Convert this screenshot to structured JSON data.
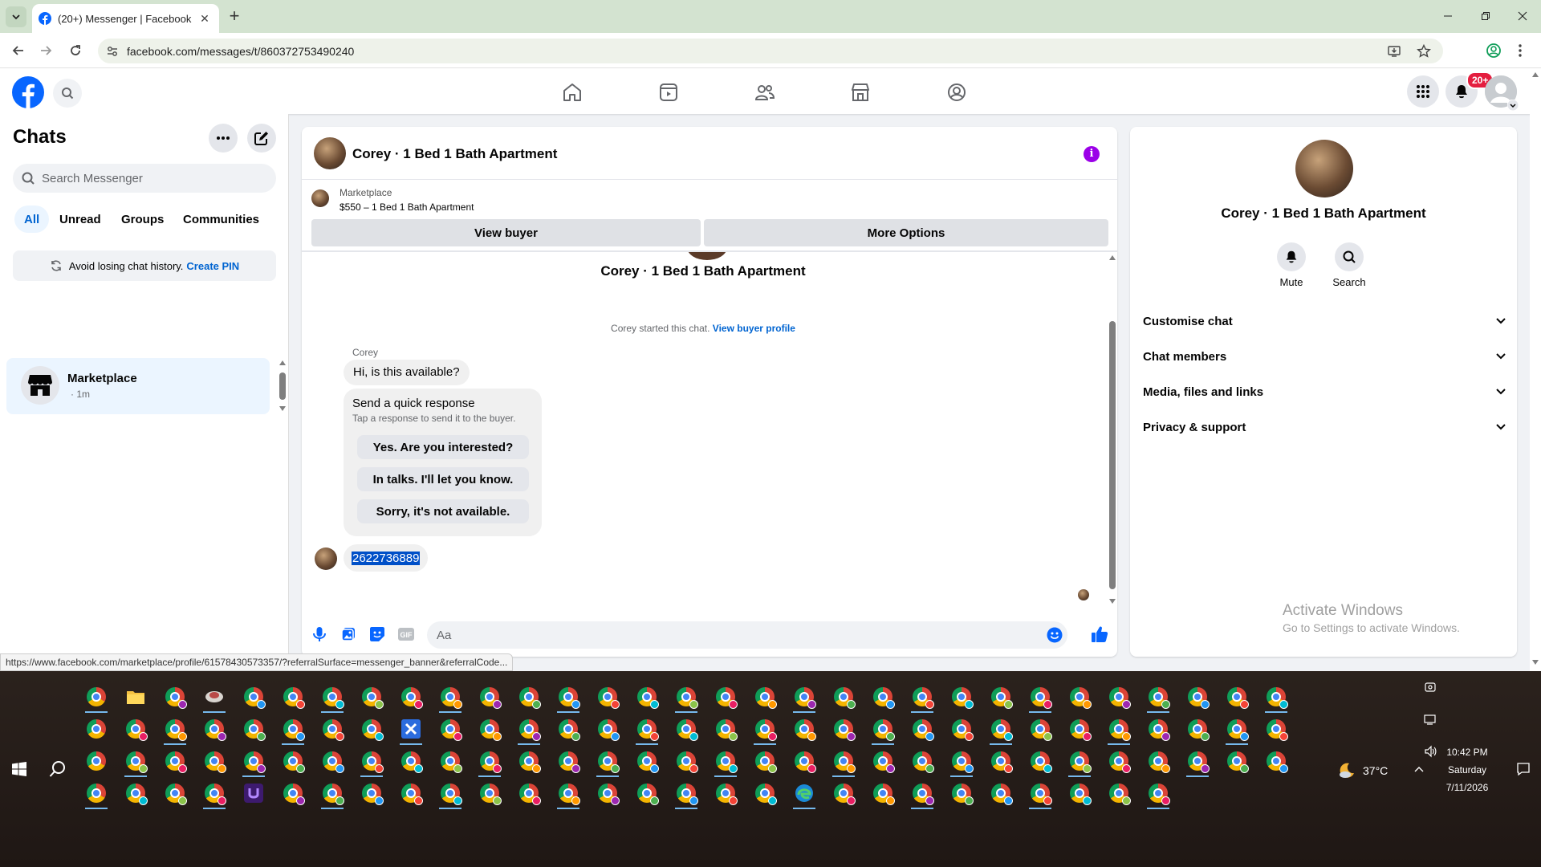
{
  "browser": {
    "tab_title": "(20+) Messenger | Facebook",
    "url": "facebook.com/messages/t/860372753490240"
  },
  "facebook": {
    "notification_badge": "20+",
    "sidebar": {
      "title": "Chats",
      "search_placeholder": "Search Messenger",
      "filters": [
        "All",
        "Unread",
        "Groups",
        "Communities"
      ],
      "pin_banner_text": "Avoid losing chat history.",
      "pin_banner_link": "Create PIN",
      "conversations": [
        {
          "name": "Marketplace",
          "time": "· 1m",
          "icon": "marketplace-store-icon"
        }
      ]
    },
    "chat": {
      "title": "Corey · 1 Bed 1 Bath Apartment",
      "marketplace_label": "Marketplace",
      "listing": "$550 – 1 Bed 1 Bath Apartment",
      "view_buyer_label": "View buyer",
      "more_options_label": "More Options",
      "center_name": "Corey · 1 Bed 1 Bath Apartment",
      "started_text": "Corey started this chat.",
      "started_link": "View buyer profile",
      "sender_name": "Corey",
      "first_message": "Hi, is this available?",
      "quick_response_title": "Send a quick response",
      "quick_response_subtitle": "Tap a response to send it to the buyer.",
      "quick_responses": [
        "Yes. Are you interested?",
        "In talks. I'll let you know.",
        "Sorry, it's not available."
      ],
      "sent_message": "2622736889",
      "composer_placeholder": "Aa"
    },
    "right_panel": {
      "name": "Corey · 1 Bed 1 Bath Apartment",
      "mute_label": "Mute",
      "search_label": "Search",
      "sections": [
        "Customise chat",
        "Chat members",
        "Media, files and links",
        "Privacy & support"
      ]
    },
    "watermark": {
      "title": "Activate Windows",
      "subtitle": "Go to Settings to activate Windows."
    }
  },
  "status_url": "https://www.facebook.com/marketplace/profile/61578430573357/?referralSurface=messenger_banner&referralCode...",
  "taskbar": {
    "weather_temp": "37°C",
    "time": "10:42 PM",
    "day": "Saturday",
    "date": "7/11/2026"
  },
  "colors": {
    "facebook_blue": "#0866ff",
    "messenger_purple": "#9b00e8",
    "link_blue": "#0064d1",
    "badge_red": "#e41e3f"
  }
}
